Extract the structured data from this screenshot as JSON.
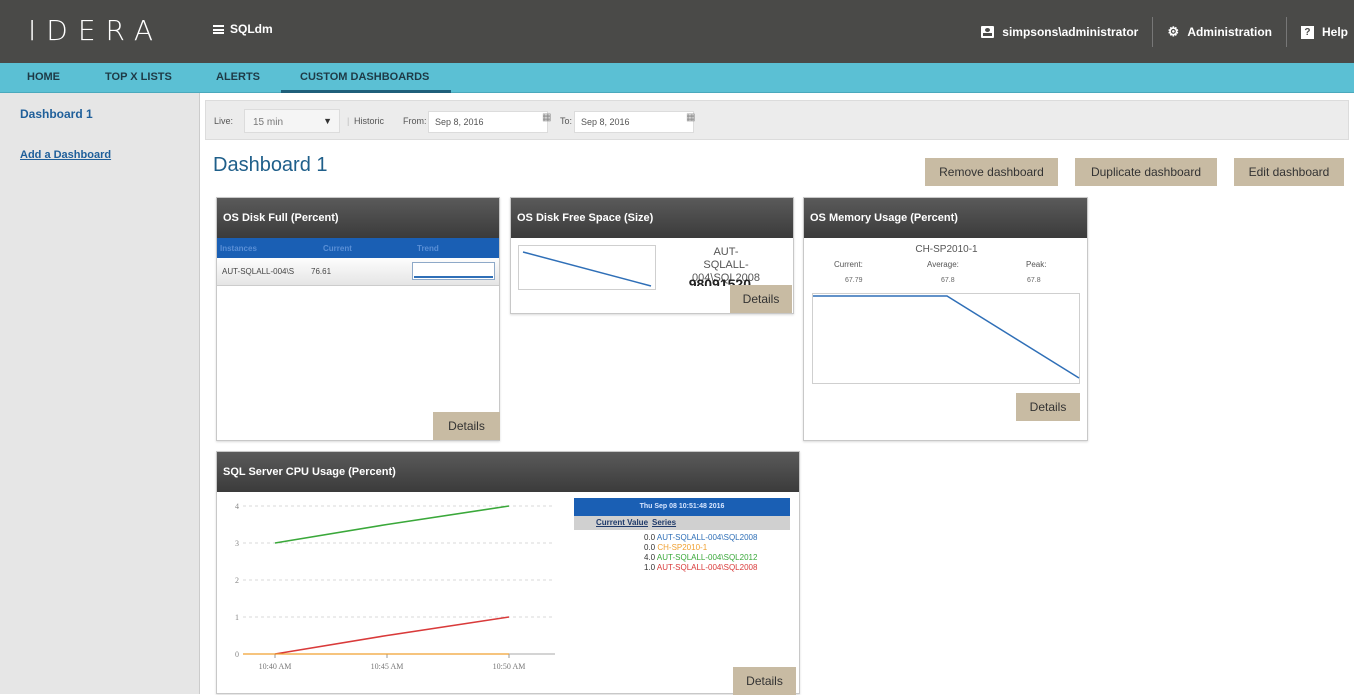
{
  "header": {
    "logo": "IDERA",
    "product": "SQLdm",
    "user": "simpsons\\administrator",
    "administration": "Administration",
    "help": "Help"
  },
  "nav": {
    "tabs": [
      {
        "label": "HOME"
      },
      {
        "label": "TOP X LISTS"
      },
      {
        "label": "ALERTS"
      },
      {
        "label": "CUSTOM DASHBOARDS",
        "active": true
      }
    ]
  },
  "sidebar": {
    "dashboard": "Dashboard 1",
    "add": "Add a Dashboard"
  },
  "filter": {
    "live_label": "Live:",
    "live_value": "15 min",
    "historic_label": "Historic",
    "from_label": "From:",
    "from_value": "Sep 8, 2016",
    "to_label": "To:",
    "to_value": "Sep 8, 2016"
  },
  "page": {
    "title": "Dashboard 1",
    "remove_btn": "Remove dashboard",
    "duplicate_btn": "Duplicate dashboard",
    "edit_btn": "Edit dashboard"
  },
  "cards": {
    "disk_full": {
      "title": "OS Disk Full (Percent)",
      "columns": [
        "Instances",
        "Current",
        "Trend"
      ],
      "row": {
        "instance": "AUT-SQLALL-004\\S",
        "current": "76.61"
      },
      "details": "Details"
    },
    "disk_free": {
      "title": "OS Disk Free Space (Size)",
      "server_line1": "AUT-SQLALL-",
      "server_line2": "004\\SQL2008",
      "value": "98091520",
      "details": "Details"
    },
    "memory": {
      "title": "OS Memory Usage (Percent)",
      "server": "CH-SP2010-1",
      "current_label": "Current:",
      "average_label": "Average:",
      "peak_label": "Peak:",
      "current": "67.79",
      "average": "67.8",
      "peak": "67.8",
      "details": "Details"
    },
    "cpu": {
      "title": "SQL Server CPU Usage (Percent)",
      "legend_title": "Thu Sep 08 10:51:48 2016",
      "col_current": "Current Value",
      "col_series": "Series",
      "details": "Details"
    }
  },
  "chart_data": {
    "type": "line",
    "x": [
      "10:40 AM",
      "10:45 AM",
      "10:50 AM"
    ],
    "ylim": [
      0,
      4
    ],
    "yticks": [
      "0",
      "1",
      "2",
      "3",
      "4"
    ],
    "series": [
      {
        "name": "AUT-SQLALL-004\\SQL2008",
        "current": "0.0",
        "color": "#2f6fb7",
        "values": [
          0,
          0,
          0
        ]
      },
      {
        "name": "CH-SP2010-1",
        "current": "0.0",
        "color": "#f0a030",
        "values": [
          0,
          0,
          0
        ]
      },
      {
        "name": "AUT-SQLALL-004\\SQL2012",
        "current": "4.0",
        "color": "#3aa83a",
        "values": [
          3,
          3.5,
          4
        ]
      },
      {
        "name": "AUT-SQLALL-004\\SQL2008",
        "current": "1.0",
        "color": "#d93a3a",
        "values": [
          0,
          0.5,
          1
        ]
      }
    ]
  }
}
